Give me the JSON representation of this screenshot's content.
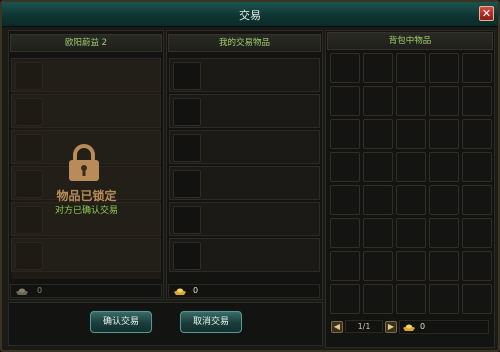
{
  "window": {
    "title": "交易"
  },
  "left_panel": {
    "header": "欧阳蔚益 2",
    "lock_title": "物品已锁定",
    "lock_subtitle": "对方已确认交易",
    "money": "0",
    "locked": true
  },
  "middle_panel": {
    "header": "我的交易物品",
    "money": "0"
  },
  "right_panel": {
    "header": "背包中物品",
    "page": "1/1",
    "money": "0"
  },
  "buttons": {
    "confirm": "确认交易",
    "cancel": "取消交易"
  },
  "icons": {
    "close": "close-icon",
    "lock": "lock-icon",
    "ingot": "gold-ingot-icon",
    "prev": "prev-page-icon",
    "next": "next-page-icon"
  },
  "colors": {
    "header_text": "#9fd06a",
    "lock_color": "#b98b58",
    "lock_subtitle": "#8fcf55",
    "button_face": "#1a3d3b",
    "close_red": "#c0392b"
  }
}
